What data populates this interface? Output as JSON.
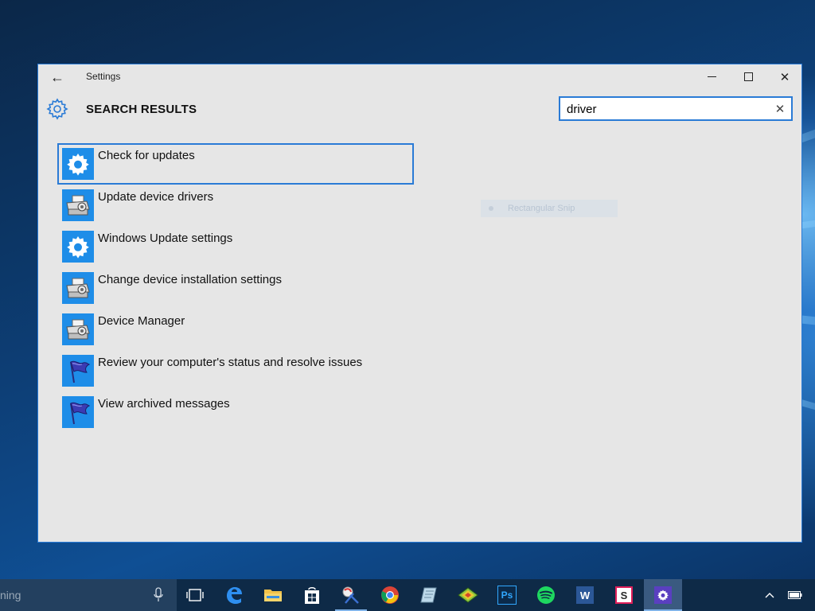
{
  "window": {
    "title": "Settings",
    "back_glyph": "←",
    "minimize_label": "Minimize",
    "maximize_label": "Maximize",
    "close_glyph": "✕"
  },
  "page": {
    "heading": "SEARCH RESULTS",
    "header_icon": "gear-icon"
  },
  "search": {
    "value": "driver",
    "clear_glyph": "✕"
  },
  "results": [
    {
      "label": "Check for updates",
      "icon": "gear-icon",
      "selected": true
    },
    {
      "label": "Update device drivers",
      "icon": "device-printer-icon",
      "selected": false
    },
    {
      "label": "Windows Update settings",
      "icon": "gear-icon",
      "selected": false
    },
    {
      "label": "Change device installation settings",
      "icon": "device-printer-icon",
      "selected": false
    },
    {
      "label": "Device Manager",
      "icon": "device-printer-icon",
      "selected": false
    },
    {
      "label": "Review your computer's status and resolve issues",
      "icon": "action-center-flag-icon",
      "selected": false
    },
    {
      "label": "View archived messages",
      "icon": "action-center-flag-icon",
      "selected": false
    }
  ],
  "ghost_overlay": {
    "label": "Rectangular Snip"
  },
  "taskbar": {
    "search_placeholder": "ning",
    "apps": [
      {
        "name": "task-view-icon"
      },
      {
        "name": "edge-icon"
      },
      {
        "name": "file-explorer-icon"
      },
      {
        "name": "store-icon"
      },
      {
        "name": "snipping-tool-icon"
      },
      {
        "name": "chrome-icon"
      },
      {
        "name": "notepad-icon"
      },
      {
        "name": "sketchup-icon"
      },
      {
        "name": "photoshop-icon",
        "text": "Ps"
      },
      {
        "name": "spotify-icon"
      },
      {
        "name": "word-icon",
        "text": "W"
      },
      {
        "name": "slack-icon",
        "text": "S"
      },
      {
        "name": "settings-app-icon"
      }
    ],
    "tray": {
      "chevron": "^",
      "battery_icon": "battery-icon"
    }
  },
  "colors": {
    "accent": "#2a7bd6",
    "tile_blue": "#1e8de8",
    "window_bg": "#e6e6e6",
    "taskbar_bg": "#0e2a47"
  }
}
